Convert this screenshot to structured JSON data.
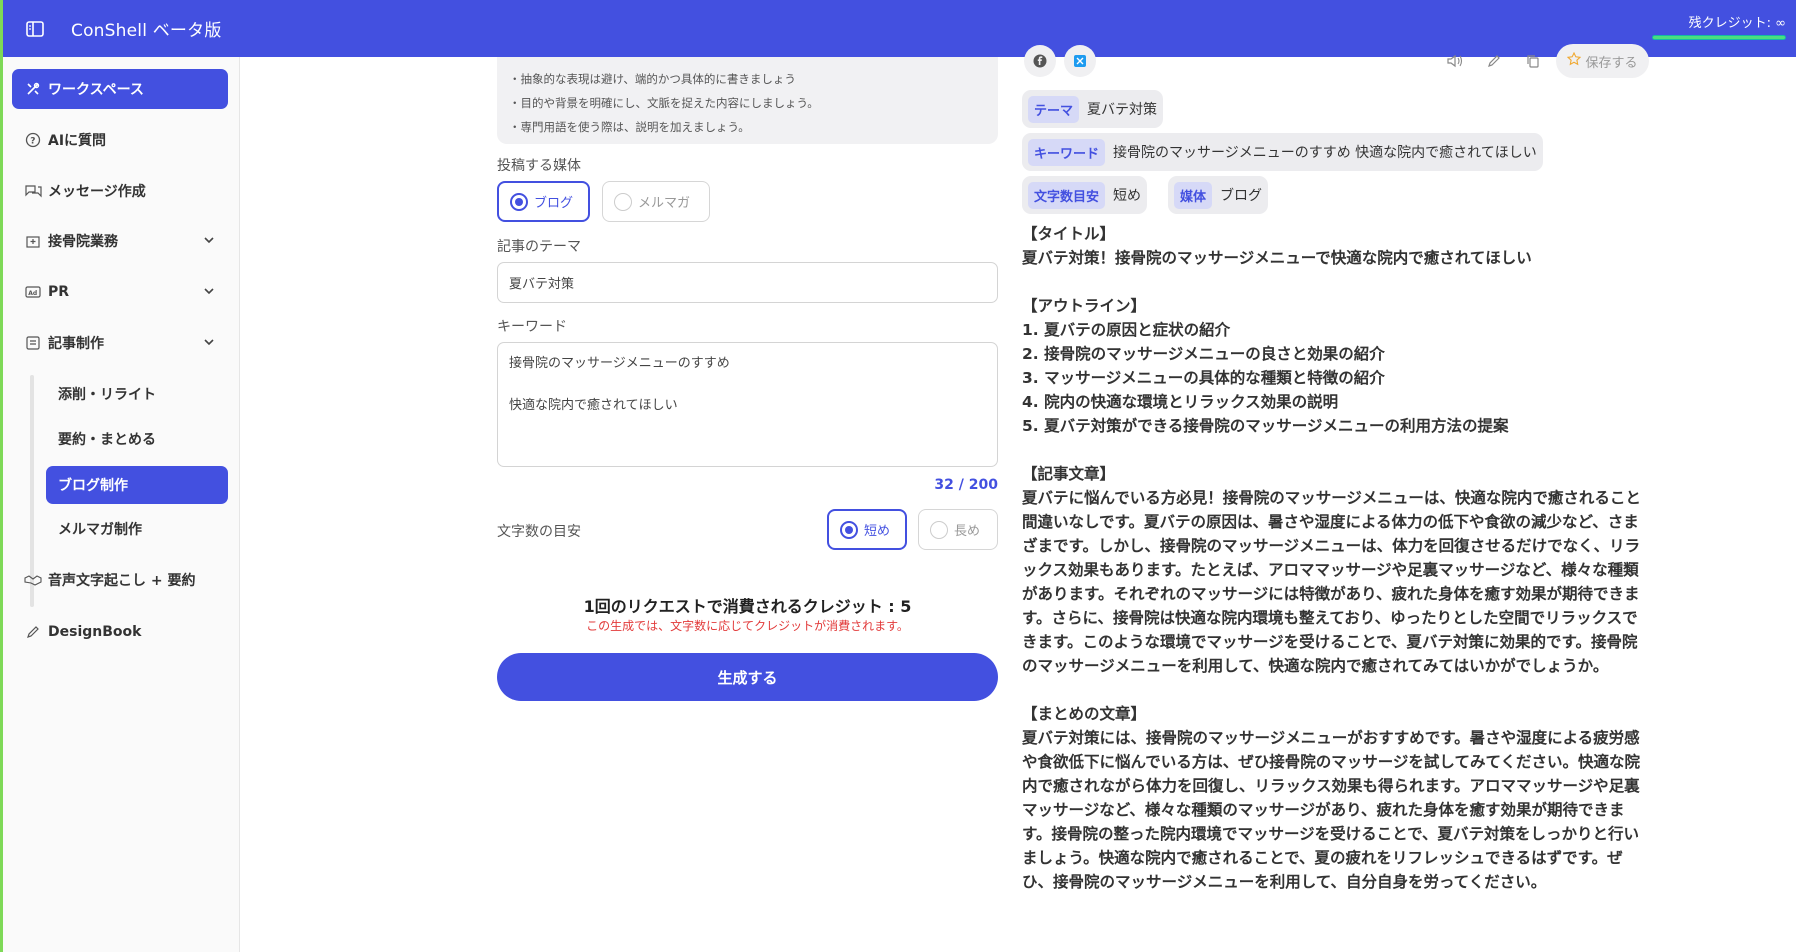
{
  "header": {
    "brand": "ConShell ベータ版",
    "credit_label": "残クレジット: ∞"
  },
  "sidebar": {
    "items": [
      {
        "label": "ワークスペース"
      },
      {
        "label": "AIに質問"
      },
      {
        "label": "メッセージ作成"
      },
      {
        "label": "接骨院業務"
      },
      {
        "label": "PR"
      },
      {
        "label": "記事制作"
      },
      {
        "label": "音声文字起こし + 要約"
      },
      {
        "label": "DesignBook"
      }
    ],
    "sub_items": [
      {
        "label": "添削・リライト"
      },
      {
        "label": "要約・まとめる"
      },
      {
        "label": "ブログ制作"
      },
      {
        "label": "メルマガ制作"
      }
    ]
  },
  "form": {
    "hints": [
      "・抽象的な表現は避け、端的かつ具体的に書きましょう",
      "・目的や背景を明確にし、文脈を捉えた内容にしましょう。",
      "・専門用語を使う際は、説明を加えましょう。"
    ],
    "media_label": "投稿する媒体",
    "media_options": [
      "ブログ",
      "メルマガ"
    ],
    "theme_label": "記事のテーマ",
    "theme_value": "夏バテ対策",
    "keyword_label": "キーワード",
    "keyword_value": "接骨院のマッサージメニューのすすめ\n\n快適な院内で癒されてほしい",
    "counter": "32 / 200",
    "length_label": "文字数の目安",
    "length_options": [
      "短め",
      "長め"
    ],
    "credit_info": "1回のリクエストで消費されるクレジット : 5",
    "credit_note": "この生成では、文字数に応じてクレジットが消費されます。",
    "generate_label": "生成する"
  },
  "output": {
    "save_label": "保存する",
    "tags": {
      "theme_key": "テーマ",
      "theme_val": "夏バテ対策",
      "keyword_key": "キーワード",
      "keyword_val": "接骨院のマッサージメニューのすすめ 快適な院内で癒されてほしい",
      "length_key": "文字数目安",
      "length_val": "短め",
      "media_key": "媒体",
      "media_val": "ブログ"
    },
    "body": "【タイトル】\n夏バテ対策！接骨院のマッサージメニューで快適な院内で癒されてほしい\n\n【アウトライン】\n1. 夏バテの原因と症状の紹介\n2. 接骨院のマッサージメニューの良さと効果の紹介\n3. マッサージメニューの具体的な種類と特徴の紹介\n4. 院内の快適な環境とリラックス効果の説明\n5. 夏バテ対策ができる接骨院のマッサージメニューの利用方法の提案\n\n【記事文章】\n夏バテに悩んでいる方必見！接骨院のマッサージメニューは、快適な院内で癒されること間違いなしです。夏バテの原因は、暑さや湿度による体力の低下や食欲の減少など、さまざまです。しかし、接骨院のマッサージメニューは、体力を回復させるだけでなく、リラックス効果もあります。たとえば、アロママッサージや足裏マッサージなど、様々な種類があります。それぞれのマッサージには特徴があり、疲れた身体を癒す効果が期待できます。さらに、接骨院は快適な院内環境も整えており、ゆったりとした空間でリラックスできます。このような環境でマッサージを受けることで、夏バテ対策に効果的です。接骨院のマッサージメニューを利用して、快適な院内で癒されてみてはいかがでしょうか。\n\n【まとめの文章】\n夏バテ対策には、接骨院のマッサージメニューがおすすめです。暑さや湿度による疲労感や食欲低下に悩んでいる方は、ぜひ接骨院のマッサージを試してみてください。快適な院内で癒されながら体力を回復し、リラックス効果も得られます。アロママッサージや足裏マッサージなど、様々な種類のマッサージがあり、疲れた身体を癒す効果が期待できます。接骨院の整った院内環境でマッサージを受けることで、夏バテ対策をしっかりと行いましょう。快適な院内で癒されることで、夏の疲れをリフレッシュできるはずです。ぜひ、接骨院のマッサージメニューを利用して、自分自身を労ってください。"
  },
  "colors": {
    "accent": "#4350e0",
    "warning": "#e23b3b"
  }
}
